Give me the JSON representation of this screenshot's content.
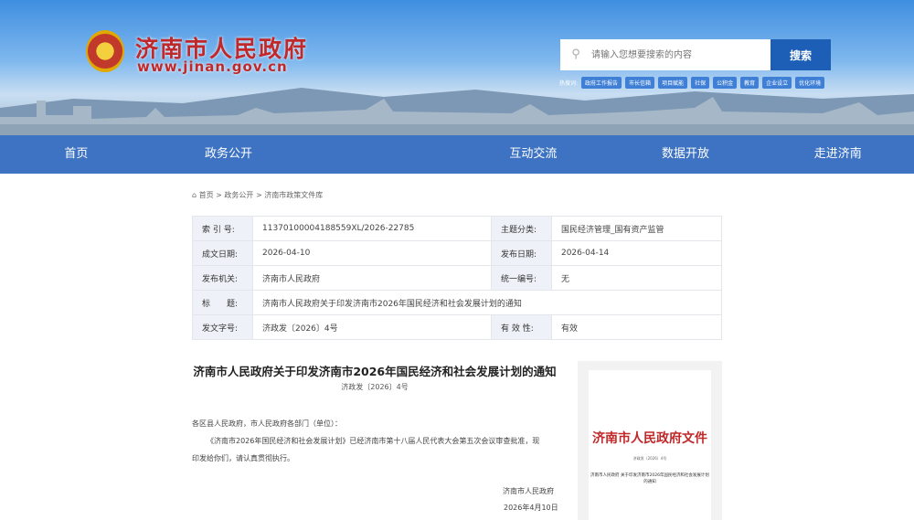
{
  "header": {
    "title": "济南市人民政府",
    "url": "www.jinan.gov.cn"
  },
  "search": {
    "placeholder": "请输入您想要搜索的内容",
    "button": "搜索",
    "hot_label": "热搜词:",
    "hot_tags": [
      "政府工作报告",
      "市长信箱",
      "项目赋能",
      "社保",
      "公积金",
      "教育",
      "企业设立",
      "优化环境"
    ]
  },
  "nav": [
    "首页",
    "政务公开",
    "",
    "互动交流",
    "数据开放",
    "走进济南"
  ],
  "breadcrumb": "首页 > 政务公开 > 济南市政策文件库",
  "meta": {
    "index_label": "索 引 号:",
    "index": "11370100004188559XL/2026-22785",
    "topic_label": "主题分类:",
    "topic": "国民经济管理_国有资产监管",
    "made_label": "成文日期:",
    "made": "2026-04-10",
    "pub_label": "发布日期:",
    "pub": "2026-04-14",
    "org_label": "发布机关:",
    "org": "济南市人民政府",
    "code_label": "统一编号:",
    "code": "无",
    "title_label": "标　　题:",
    "title": "济南市人民政府关于印发济南市2026年国民经济和社会发展计划的通知",
    "docno_label": "发文字号:",
    "docno": "济政发〔2026〕4号",
    "valid_label": "有 效 性:",
    "valid": "有效"
  },
  "doc": {
    "title": "济南市人民政府关于印发济南市2026年国民经济和社会发展计划的通知",
    "number": "济政发〔2026〕4号",
    "salutation": "各区县人民政府，市人民政府各部门（单位）：",
    "body1": "《济南市2026年国民经济和社会发展计划》已经济南市第十八届人民代表大会第五次会议审查批准，现",
    "body2": "印发给你们，请认真贯彻执行。",
    "signer": "济南市人民政府",
    "date": "2026年4月10日"
  },
  "thumbnail": {
    "head": "济南市人民政府文件",
    "number": "济政发〔2026〕4号",
    "caption": "济南市人民政府 关于印发济南市2026年国民经济和社会发展计划的通知"
  }
}
